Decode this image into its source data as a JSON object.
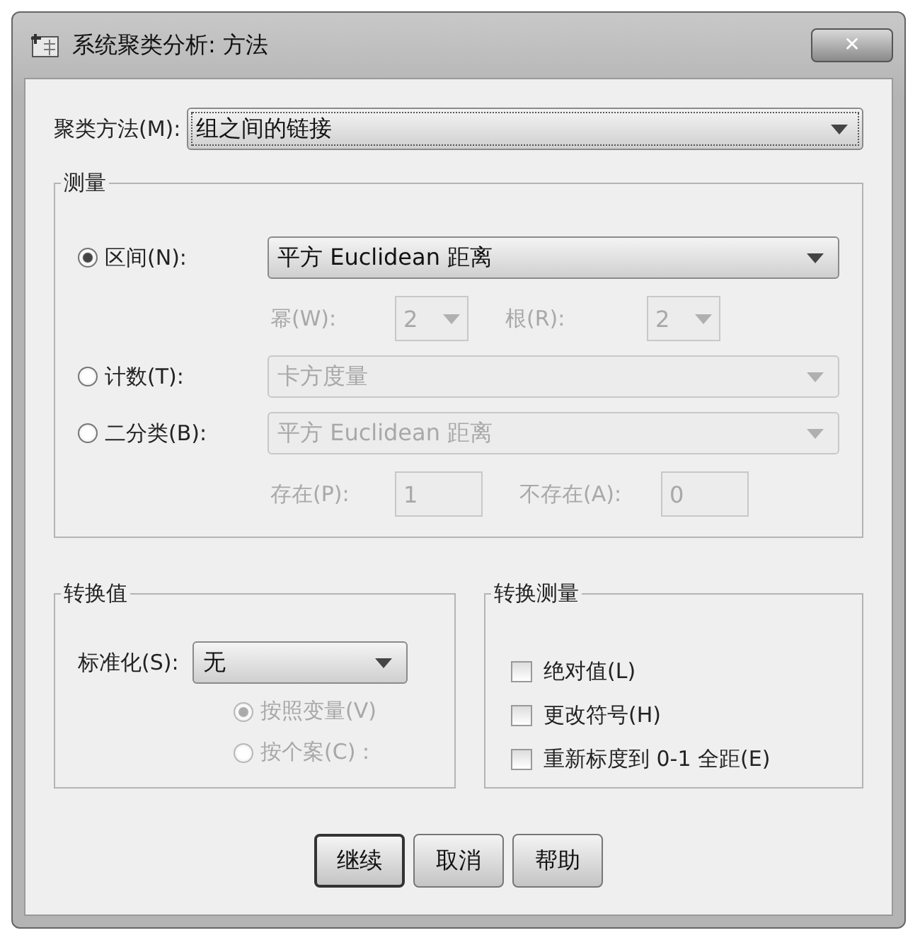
{
  "window": {
    "title": "系统聚类分析: 方法",
    "close": "✕"
  },
  "method": {
    "label": "聚类方法(M):",
    "value": "组之间的链接"
  },
  "measure": {
    "title": "测量",
    "options": [
      {
        "kind": "combo",
        "label": "区间(N):",
        "selected": true,
        "value": "平方 Euclidean 距离",
        "disabled": false,
        "sub": [
          {
            "kind": "spin",
            "label": "幂(W):",
            "value": "2"
          },
          {
            "kind": "spin",
            "label": "根(R):",
            "value": "2"
          }
        ],
        "sub_disabled": true
      },
      {
        "kind": "combo",
        "label": "计数(T):",
        "selected": false,
        "value": "卡方度量",
        "disabled": true
      },
      {
        "kind": "combo",
        "label": "二分类(B):",
        "selected": false,
        "value": "平方 Euclidean 距离",
        "disabled": true,
        "sub": [
          {
            "kind": "text",
            "label": "存在(P):",
            "value": "1"
          },
          {
            "kind": "text",
            "label": "不存在(A):",
            "value": "0"
          }
        ],
        "sub_disabled": true
      }
    ]
  },
  "transform_values": {
    "title": "转换值",
    "label": "标准化(S):",
    "value": "无",
    "options": [
      {
        "label": "按照变量(V)",
        "selected": true,
        "disabled": true
      },
      {
        "label": "按个案(C)：",
        "selected": false,
        "disabled": true
      }
    ]
  },
  "transform_measures": {
    "title": "转换测量",
    "options": [
      {
        "label": "绝对值(L)",
        "checked": false
      },
      {
        "label": "更改符号(H)",
        "checked": false
      },
      {
        "label": "重新标度到 0-1 全距(E)",
        "checked": false
      }
    ]
  },
  "buttons": [
    {
      "label": "继续",
      "default": true
    },
    {
      "label": "取消",
      "default": false
    },
    {
      "label": "帮助",
      "default": false
    }
  ]
}
